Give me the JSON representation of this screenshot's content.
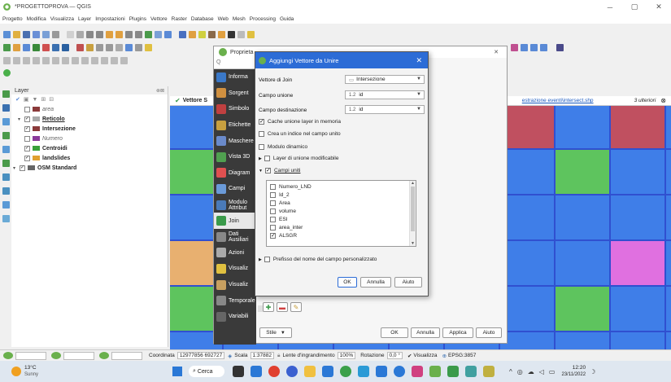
{
  "window": {
    "title": "*PROGETTOPROVA — QGIS"
  },
  "menu": [
    "Progetto",
    "Modifica",
    "Visualizza",
    "Layer",
    "Impostazioni",
    "Plugins",
    "Vettore",
    "Raster",
    "Database",
    "Web",
    "Mesh",
    "Processing",
    "Guida"
  ],
  "layers_panel": {
    "title": "Layer",
    "items": [
      {
        "name": "area",
        "checked": false,
        "italic": true,
        "color": "#8b3a3a"
      },
      {
        "name": "Reticolo",
        "checked": true,
        "bold": true,
        "color": "#aaa"
      },
      {
        "name": "Intersezione",
        "checked": true,
        "bold": true,
        "color": "#8b3a3a"
      },
      {
        "name": "Numero",
        "checked": false,
        "italic": true,
        "color": "#8b3a9a"
      },
      {
        "name": "Centroidi",
        "checked": true,
        "bold": true,
        "color": "#3aa03a"
      },
      {
        "name": "landslides",
        "checked": true,
        "bold": true,
        "color": "#e0a030"
      },
      {
        "name": "OSM Standard",
        "checked": true,
        "bold": true,
        "color": "#666"
      }
    ]
  },
  "map_header": {
    "title": "Vettore S",
    "link": "estrazione eventi\\intersect.shp",
    "more": "3 ulteriori"
  },
  "properties": {
    "title": "Proprieta",
    "search_placeholder": "Q",
    "nav": [
      {
        "label": "Informa",
        "color": "#3a78c8"
      },
      {
        "label": "Sorgent",
        "color": "#d09040"
      },
      {
        "label": "Simbolo",
        "color": "#c04040"
      },
      {
        "label": "Etichette",
        "color": "#c8a040"
      },
      {
        "label": "Maschere",
        "color": "#6a8aca"
      },
      {
        "label": "Vista 3D",
        "color": "#50a050"
      },
      {
        "label": "Diagram",
        "color": "#e05050"
      },
      {
        "label": "Campi",
        "color": "#6a9ad8"
      },
      {
        "label": "Modulo Attribut",
        "color": "#4a7ab8"
      },
      {
        "label": "Join",
        "color": "#3a9a4a"
      },
      {
        "label": "Dati Ausiliari",
        "color": "#888"
      },
      {
        "label": "Azioni",
        "color": "#aaa"
      },
      {
        "label": "Visualiz",
        "color": "#e0c040"
      },
      {
        "label": "Visualiz",
        "color": "#c8a060"
      },
      {
        "label": "Temporale",
        "color": "#888"
      },
      {
        "label": "Variabili",
        "color": "#666"
      }
    ],
    "style_label": "Stile",
    "buttons": [
      "OK",
      "Annulla",
      "Applica",
      "Aiuto"
    ]
  },
  "dialog": {
    "title": "Aggiungi Vettore da Unire",
    "join_layer_label": "Vettore di Join",
    "join_layer_value": "Intersezione",
    "join_field_label": "Campo unione",
    "join_field_value": "id",
    "target_field_label": "Campo destinazione",
    "target_field_value": "id",
    "field_type": "1.2",
    "options": [
      {
        "label": "Cache unione layer in memoria",
        "checked": true
      },
      {
        "label": "Crea un indice nel campo unito",
        "checked": false
      },
      {
        "label": "Modulo dinamico",
        "checked": false
      },
      {
        "label": "Layer di unione modificabile",
        "checked": false
      }
    ],
    "joined_fields_label": "Campi uniti",
    "fields": [
      {
        "name": "Numero_LND",
        "checked": false
      },
      {
        "name": "Id_2",
        "checked": false
      },
      {
        "name": "Area",
        "checked": false
      },
      {
        "name": "volume",
        "checked": false
      },
      {
        "name": "ESI",
        "checked": false
      },
      {
        "name": "area_inter",
        "checked": false
      },
      {
        "name": "ALSGR",
        "checked": true
      }
    ],
    "prefix_label": "Prefisso del nome del campo personalizzato",
    "buttons": [
      "OK",
      "Annulla",
      "Aiuto"
    ]
  },
  "status": {
    "coords_label": "Coordinata",
    "coords": "12977856 692727",
    "scale_label": "Scala",
    "scale": "1:37882",
    "magnifier_label": "Lente d'ingrandimento",
    "magnifier": "100%",
    "rotation_label": "Rotazione",
    "rotation": "0,0 °",
    "render_label": "Visualizza",
    "crs": "EPSG:3857"
  },
  "taskbar": {
    "weather_temp": "13°C",
    "weather_desc": "Sunny",
    "search": "Cerca",
    "time": "12:20",
    "date": "23/11/2022"
  },
  "colors": {
    "accent": "#2c6cd6",
    "grid_green": "#5ec45e",
    "grid_blue": "#3f7ee8",
    "grid_magenta": "#e070e0",
    "grid_orange": "#e8b070",
    "grid_red": "#c05060"
  }
}
